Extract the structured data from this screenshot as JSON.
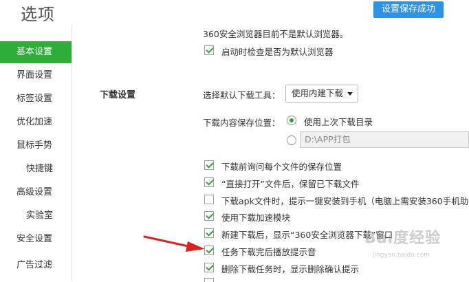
{
  "header": {
    "title": "选项",
    "save_status": "设置保存成功"
  },
  "sidebar": {
    "items": [
      {
        "label": "基本设置",
        "active": true
      },
      {
        "label": "界面设置"
      },
      {
        "label": "标签设置"
      },
      {
        "label": "优化加速"
      },
      {
        "label": "鼠标手势"
      },
      {
        "label": "快捷键"
      },
      {
        "label": "高级设置"
      },
      {
        "label": "实验室"
      },
      {
        "label": "安全设置"
      },
      {
        "label": "广告过滤"
      }
    ]
  },
  "default_browser": {
    "status_text": "360安全浏览器目前不是默认浏览器。",
    "check_on_start": "启动时检查是否为默认浏览器"
  },
  "download": {
    "section_title": "下载设置",
    "tool_label": "选择默认下载工具：",
    "tool_selected": "使用内建下载",
    "location_label": "下载内容保存位置：",
    "option_last_dir": "使用上次下载目录",
    "custom_path": "D:\\APP打包",
    "options": [
      {
        "label": "下载前询问每个文件的保存位置",
        "checked": true
      },
      {
        "label": "“直接打开”文件后，保留已下载文件",
        "checked": true
      },
      {
        "label": "下载apk文件时，提示一键安装到手机（电脑上需安装360手机助",
        "checked": false
      },
      {
        "label": "使用下载加速模块",
        "checked": true
      },
      {
        "label": "新建下载后，显示“360安全浏览器下载”窗口",
        "checked": true
      },
      {
        "label": "任务下载完后播放提示音",
        "checked": true
      },
      {
        "label": "删除下载任务时，显示删除确认提示",
        "checked": true
      }
    ]
  },
  "watermark": {
    "brand": "Bai度经验",
    "url": "jingyan.baidu.com"
  },
  "colors": {
    "accent_green": "#2fad3a",
    "button_blue": "#2e93e6",
    "arrow_red": "#e02020"
  }
}
